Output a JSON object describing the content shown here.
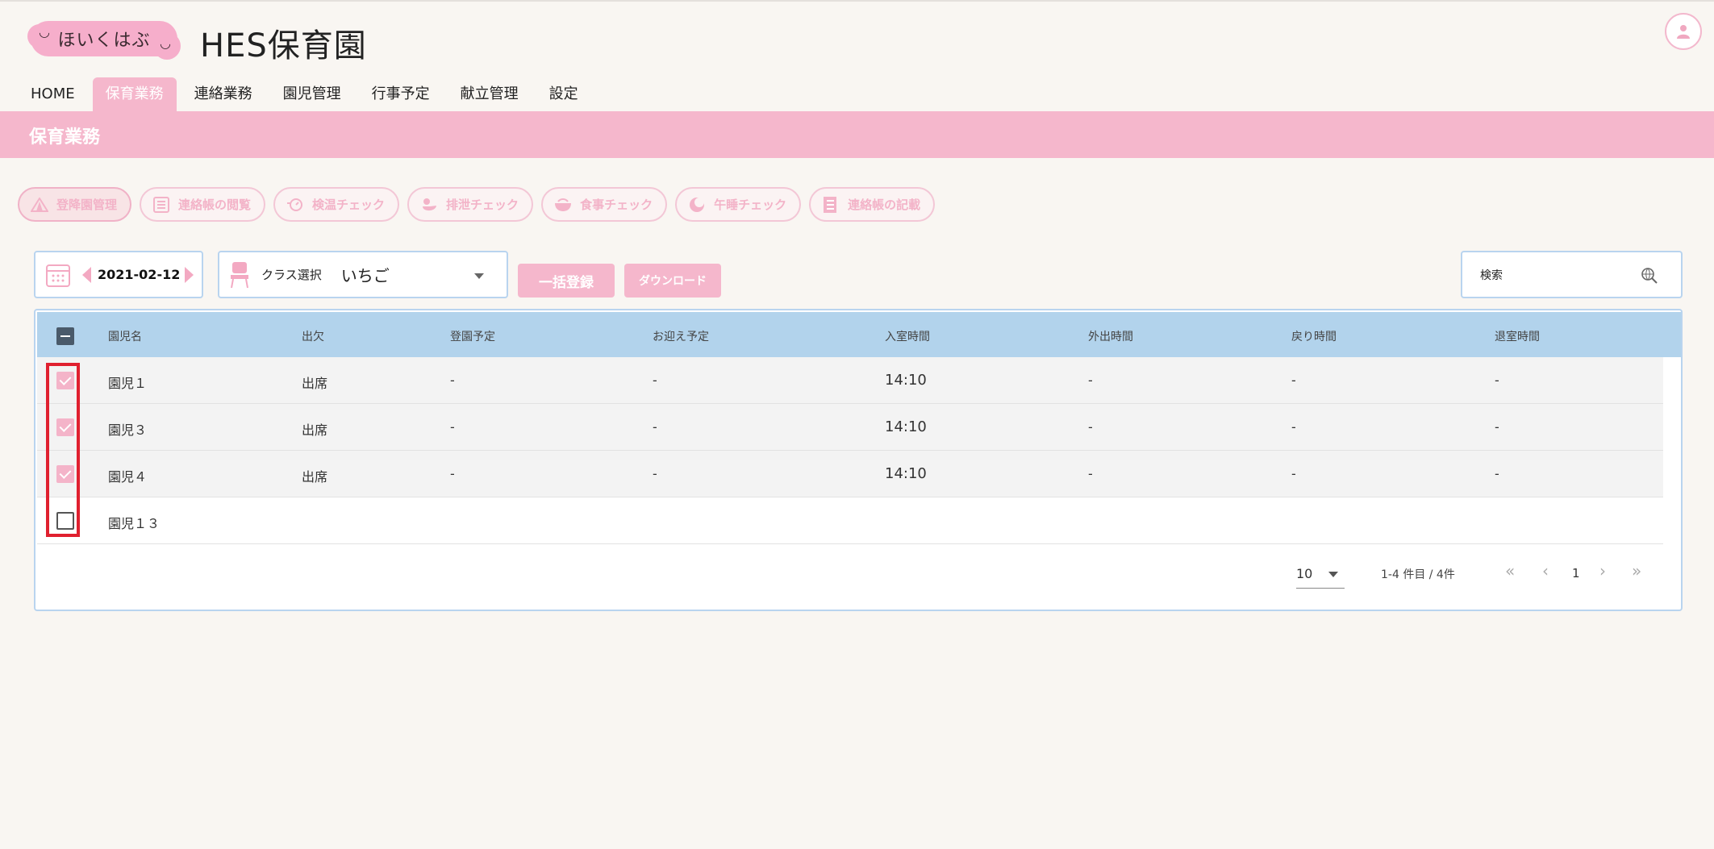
{
  "header": {
    "logo_text": "ほいくはぶ",
    "app_title": "HES保育園"
  },
  "nav": {
    "tabs": [
      {
        "label": "HOME"
      },
      {
        "label": "保育業務"
      },
      {
        "label": "連絡業務"
      },
      {
        "label": "園児管理"
      },
      {
        "label": "行事予定"
      },
      {
        "label": "献立管理"
      },
      {
        "label": "設定"
      }
    ],
    "active_tab": "保育業務"
  },
  "section": {
    "title": "保育業務"
  },
  "submenu": [
    {
      "label": "登降園管理",
      "icon": "tent-icon"
    },
    {
      "label": "連絡帳の閲覧",
      "icon": "list-icon"
    },
    {
      "label": "検温チェック",
      "icon": "thermometer-icon"
    },
    {
      "label": "排泄チェック",
      "icon": "duck-icon"
    },
    {
      "label": "食事チェック",
      "icon": "bowl-icon"
    },
    {
      "label": "午睡チェック",
      "icon": "sleep-icon"
    },
    {
      "label": "連絡帳の記載",
      "icon": "notebook-icon"
    }
  ],
  "toolbar": {
    "date": "2021-02-12",
    "class_label": "クラス選択",
    "class_value": "いちご",
    "bulk_button": "一括登録",
    "download_button": "ダウンロード",
    "search_placeholder": "検索"
  },
  "table": {
    "columns": [
      "園児名",
      "出欠",
      "登園予定",
      "お迎え予定",
      "入室時間",
      "外出時間",
      "戻り時間",
      "退室時間"
    ],
    "rows": [
      {
        "checked": true,
        "name": "園児１",
        "attendance": "出席",
        "arrival_plan": "-",
        "pickup_plan": "-",
        "entry_time": "14:10",
        "out_time": "-",
        "return_time": "-",
        "exit_time": "-"
      },
      {
        "checked": true,
        "name": "園児３",
        "attendance": "出席",
        "arrival_plan": "-",
        "pickup_plan": "-",
        "entry_time": "14:10",
        "out_time": "-",
        "return_time": "-",
        "exit_time": "-"
      },
      {
        "checked": true,
        "name": "園児４",
        "attendance": "出席",
        "arrival_plan": "-",
        "pickup_plan": "-",
        "entry_time": "14:10",
        "out_time": "-",
        "return_time": "-",
        "exit_time": "-"
      },
      {
        "checked": false,
        "name": "園児１３",
        "attendance": "",
        "arrival_plan": "",
        "pickup_plan": "",
        "entry_time": "",
        "out_time": "",
        "return_time": "",
        "exit_time": ""
      }
    ]
  },
  "pagination": {
    "per_page": "10",
    "range_text": "1-4 件目 / 4件",
    "current_page": "1"
  },
  "colors": {
    "accent_pink": "#f5b7cc",
    "header_blue": "#b2d3ec",
    "highlight_red": "#e0202f"
  }
}
